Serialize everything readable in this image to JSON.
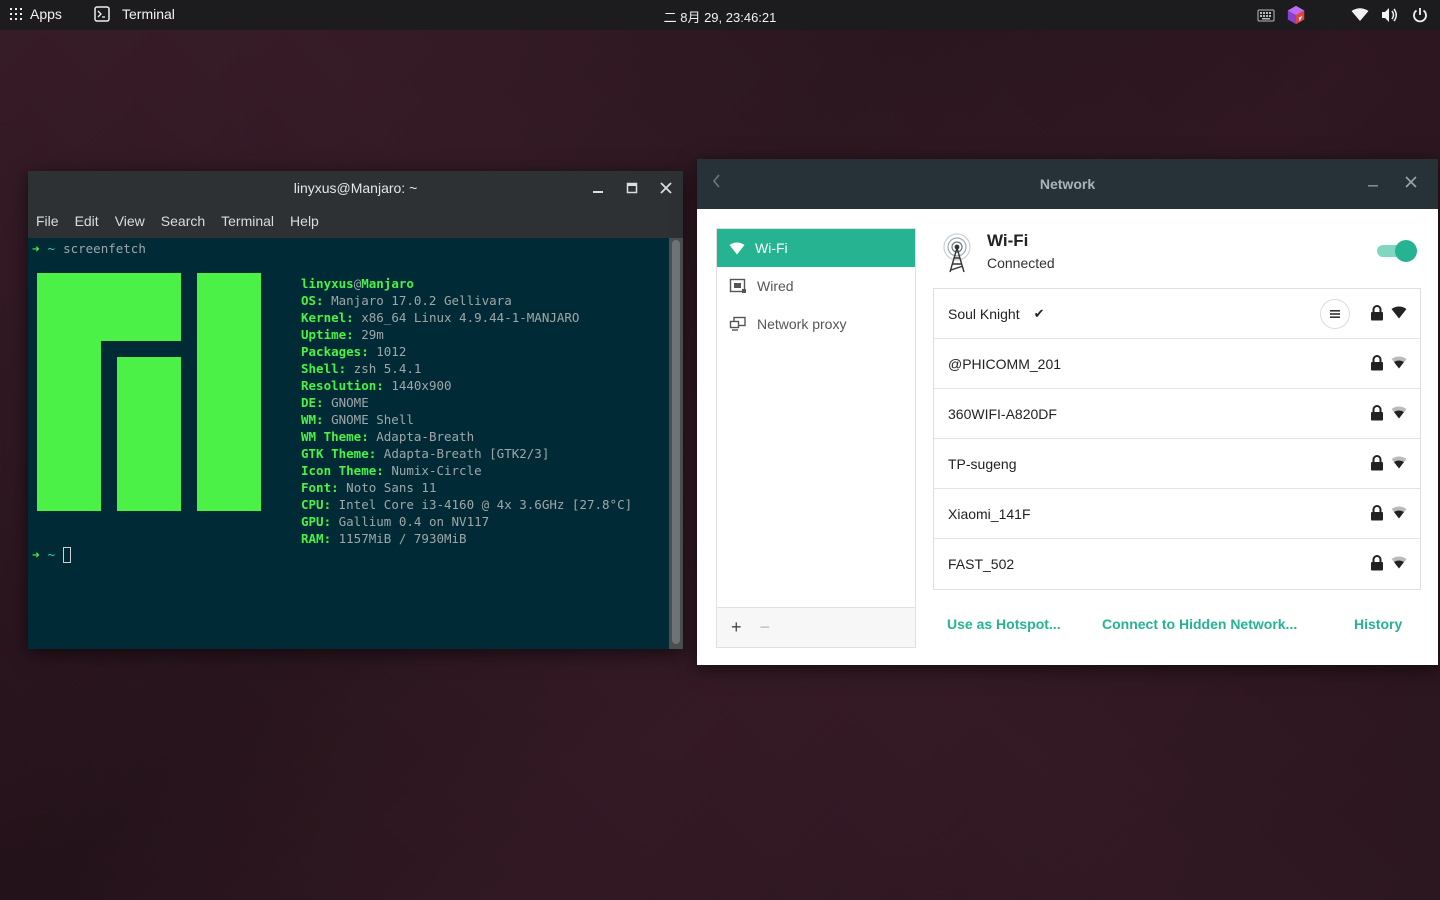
{
  "topbar": {
    "apps_label": "Apps",
    "active_app_label": "Terminal",
    "clock": "二 8月 29, 23:46:21"
  },
  "terminal": {
    "title": "linyxus@Manjaro: ~",
    "menu": [
      "File",
      "Edit",
      "View",
      "Search",
      "Terminal",
      "Help"
    ],
    "prompt_arrow": "➜",
    "prompt_dir": "~",
    "command": "screenfetch",
    "user": "linyxus",
    "at": "@",
    "host": "Manjaro",
    "info": [
      {
        "key": "OS:",
        "value": " Manjaro 17.0.2 Gellivara"
      },
      {
        "key": "Kernel:",
        "value": " x86_64 Linux 4.9.44-1-MANJARO"
      },
      {
        "key": "Uptime:",
        "value": " 29m"
      },
      {
        "key": "Packages:",
        "value": " 1012"
      },
      {
        "key": "Shell:",
        "value": " zsh 5.4.1"
      },
      {
        "key": "Resolution:",
        "value": " 1440x900"
      },
      {
        "key": "DE:",
        "value": " GNOME"
      },
      {
        "key": "WM:",
        "value": " GNOME Shell"
      },
      {
        "key": "WM Theme:",
        "value": " Adapta-Breath"
      },
      {
        "key": "GTK Theme:",
        "value": " Adapta-Breath [GTK2/3]"
      },
      {
        "key": "Icon Theme:",
        "value": " Numix-Circle"
      },
      {
        "key": "Font:",
        "value": " Noto Sans 11"
      },
      {
        "key": "CPU:",
        "value": " Intel Core i3-4160 @ 4x 3.6GHz [27.8°C]"
      },
      {
        "key": "GPU:",
        "value": " Gallium 0.4 on NV117"
      },
      {
        "key": "RAM:",
        "value": " 1157MiB / 7930MiB"
      }
    ]
  },
  "network": {
    "title": "Network",
    "sidebar": [
      {
        "label": "Wi-Fi",
        "icon": "wifi-icon",
        "active": true
      },
      {
        "label": "Wired",
        "icon": "wired-icon",
        "active": false
      },
      {
        "label": "Network proxy",
        "icon": "network-proxy-icon",
        "active": false
      }
    ],
    "add_label": "+",
    "remove_label": "−",
    "wifi_title": "Wi-Fi",
    "wifi_status": "Connected",
    "wifi_enabled": true,
    "networks": [
      {
        "ssid": "Soul Knight",
        "connected": true,
        "check": "✔",
        "secured": true
      },
      {
        "ssid": "@PHICOMM_201",
        "connected": false,
        "secured": true
      },
      {
        "ssid": "360WIFI-A820DF",
        "connected": false,
        "secured": true
      },
      {
        "ssid": "TP-sugeng",
        "connected": false,
        "secured": true
      },
      {
        "ssid": "Xiaomi_141F",
        "connected": false,
        "secured": true
      },
      {
        "ssid": "FAST_502",
        "connected": false,
        "secured": true
      }
    ],
    "actions": {
      "hotspot": "Use as Hotspot...",
      "hidden": "Connect to Hidden Network...",
      "history": "History"
    }
  },
  "colors": {
    "accent": "#25b392",
    "terminal_bg": "#002b36",
    "screenfetch_green": "#4bf146"
  }
}
